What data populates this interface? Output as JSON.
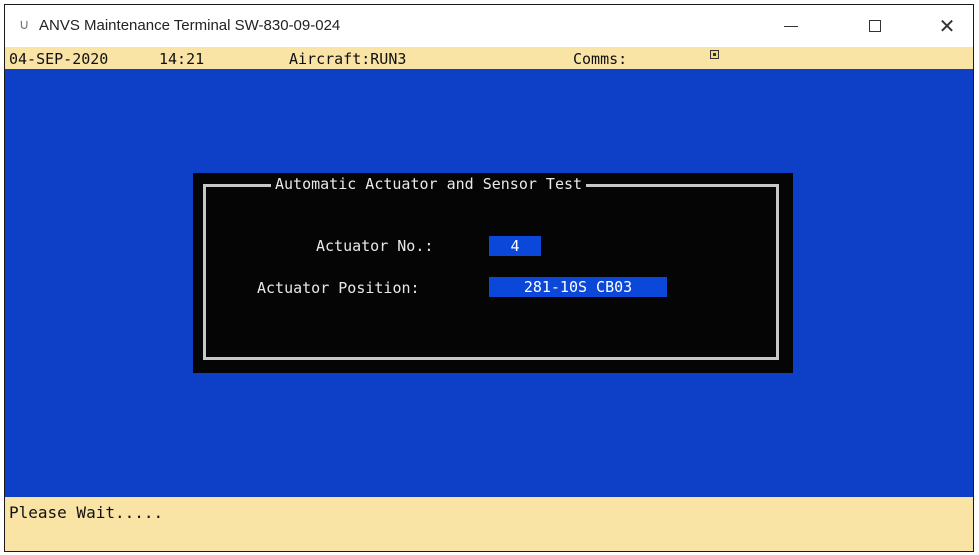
{
  "window": {
    "title": "ANVS Maintenance Terminal SW-830-09-024",
    "icon": "terminal-app-icon",
    "controls": {
      "minimize": "minimize-icon",
      "maximize": "maximize-icon",
      "close": "close-icon"
    }
  },
  "status": {
    "date": "04-SEP-2020",
    "time": "14:21",
    "aircraft": "Aircraft:RUN3",
    "comms_label": "Comms:"
  },
  "dialog": {
    "title": "Automatic Actuator and Sensor Test",
    "actuator_no_label": "Actuator No.:",
    "actuator_no_value": "4",
    "actuator_position_label": "Actuator Position:",
    "actuator_position_value": "281-10S CB03"
  },
  "footer": {
    "message": "Please Wait....."
  },
  "colors": {
    "terminal_background": "#0e3fc7",
    "status_bar": "#f9e3a5",
    "dialog_background": "#050505",
    "field_highlight": "#0b47d8"
  }
}
